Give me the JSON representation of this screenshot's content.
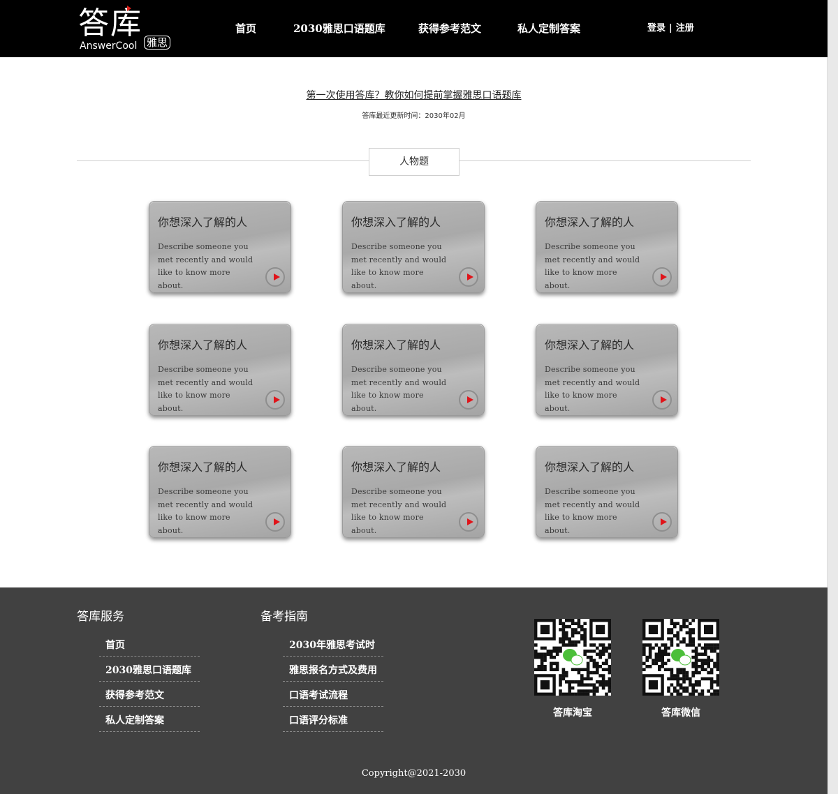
{
  "header": {
    "logo_main": "答库",
    "logo_sub": "AnswerCool",
    "logo_badge": "雅思",
    "nav": [
      "首页",
      "2030雅思口语题库",
      "获得参考范文",
      "私人定制答案"
    ],
    "login": "登录",
    "auth_sep": "|",
    "register": "注册"
  },
  "intro": {
    "link": "第一次使用答库？教你如何提前掌握雅思口语题库",
    "update": "答库最近更新时间：2030年02月"
  },
  "section": {
    "title": "人物题"
  },
  "cards": [
    {
      "title": "你想深入了解的人",
      "desc": "Describe someone you met recently and would like to know more about."
    },
    {
      "title": "你想深入了解的人",
      "desc": "Describe someone you met recently and would like to know more about."
    },
    {
      "title": "你想深入了解的人",
      "desc": "Describe someone you met recently and would like to know more about."
    },
    {
      "title": "你想深入了解的人",
      "desc": "Describe someone you met recently and would like to know more about."
    },
    {
      "title": "你想深入了解的人",
      "desc": "Describe someone you met recently and would like to know more about."
    },
    {
      "title": "你想深入了解的人",
      "desc": "Describe someone you met recently and would like to know more about."
    },
    {
      "title": "你想深入了解的人",
      "desc": "Describe someone you met recently and would like to know more about."
    },
    {
      "title": "你想深入了解的人",
      "desc": "Describe someone you met recently and would like to know more about."
    },
    {
      "title": "你想深入了解的人",
      "desc": "Describe someone you met recently and would like to know more about."
    }
  ],
  "footer": {
    "services": {
      "title": "答库服务",
      "items": [
        "首页",
        "2030雅思口语题库",
        "获得参考范文",
        "私人定制答案"
      ]
    },
    "guide": {
      "title": "备考指南",
      "items": [
        "2030年雅思考试时",
        "雅思报名方式及费用",
        "口语考试流程",
        "口语评分标准"
      ]
    },
    "qr": [
      {
        "label": "答库淘宝",
        "icon": "wechat-qr-code-icon"
      },
      {
        "label": "答库微信",
        "icon": "wechat-qr-code-icon"
      }
    ],
    "copyright": "Copyright@2021-2030"
  },
  "colors": {
    "header_bg": "#000000",
    "footer_bg": "#414141",
    "play_accent": "#e0141a",
    "logo_accent": "#e0201a"
  }
}
